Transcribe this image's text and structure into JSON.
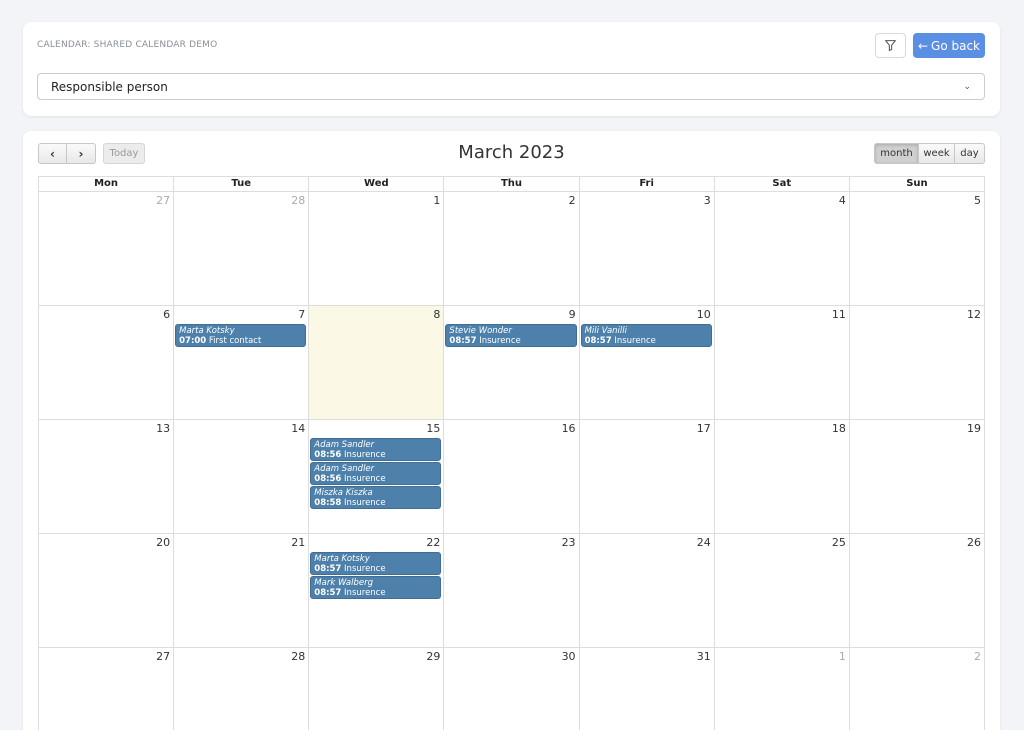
{
  "header": {
    "breadcrumb": "CALENDAR: SHARED CALENDAR DEMO",
    "back_label": "Go back",
    "select_value": "Responsible person"
  },
  "calendar": {
    "title": "March 2023",
    "today_label": "Today",
    "views": [
      "month",
      "week",
      "day"
    ],
    "weekdays": [
      "Mon",
      "Tue",
      "Wed",
      "Thu",
      "Fri",
      "Sat",
      "Sun"
    ],
    "weeks": [
      [
        {
          "num": "27",
          "other": true,
          "events": []
        },
        {
          "num": "28",
          "other": true,
          "events": []
        },
        {
          "num": "1",
          "events": []
        },
        {
          "num": "2",
          "events": []
        },
        {
          "num": "3",
          "events": []
        },
        {
          "num": "4",
          "events": []
        },
        {
          "num": "5",
          "events": []
        }
      ],
      [
        {
          "num": "6",
          "events": []
        },
        {
          "num": "7",
          "events": [
            {
              "who": "Marta Kotsky",
              "time": "07:00",
              "title": "First contact"
            }
          ]
        },
        {
          "num": "8",
          "today": true,
          "events": []
        },
        {
          "num": "9",
          "events": [
            {
              "who": "Stevie Wonder",
              "time": "08:57",
              "title": "Insurence"
            }
          ]
        },
        {
          "num": "10",
          "events": [
            {
              "who": "Mili Vanilli",
              "time": "08:57",
              "title": "Insurence"
            }
          ]
        },
        {
          "num": "11",
          "events": []
        },
        {
          "num": "12",
          "events": []
        }
      ],
      [
        {
          "num": "13",
          "events": []
        },
        {
          "num": "14",
          "events": []
        },
        {
          "num": "15",
          "events": [
            {
              "who": "Adam Sandler",
              "time": "08:56",
              "title": "Insurence"
            },
            {
              "who": "Adam Sandler",
              "time": "08:56",
              "title": "Insurence"
            },
            {
              "who": "Miszka Kiszka",
              "time": "08:58",
              "title": "Insurence"
            }
          ]
        },
        {
          "num": "16",
          "events": []
        },
        {
          "num": "17",
          "events": []
        },
        {
          "num": "18",
          "events": []
        },
        {
          "num": "19",
          "events": []
        }
      ],
      [
        {
          "num": "20",
          "events": []
        },
        {
          "num": "21",
          "events": []
        },
        {
          "num": "22",
          "events": [
            {
              "who": "Marta Kotsky",
              "time": "08:57",
              "title": "Insurence"
            },
            {
              "who": "Mark Walberg",
              "time": "08:57",
              "title": "Insurence"
            }
          ]
        },
        {
          "num": "23",
          "events": []
        },
        {
          "num": "24",
          "events": []
        },
        {
          "num": "25",
          "events": []
        },
        {
          "num": "26",
          "events": []
        }
      ],
      [
        {
          "num": "27",
          "events": []
        },
        {
          "num": "28",
          "events": []
        },
        {
          "num": "29",
          "events": []
        },
        {
          "num": "30",
          "events": []
        },
        {
          "num": "31",
          "events": []
        },
        {
          "num": "1",
          "other": true,
          "events": []
        },
        {
          "num": "2",
          "other": true,
          "events": []
        }
      ]
    ]
  }
}
